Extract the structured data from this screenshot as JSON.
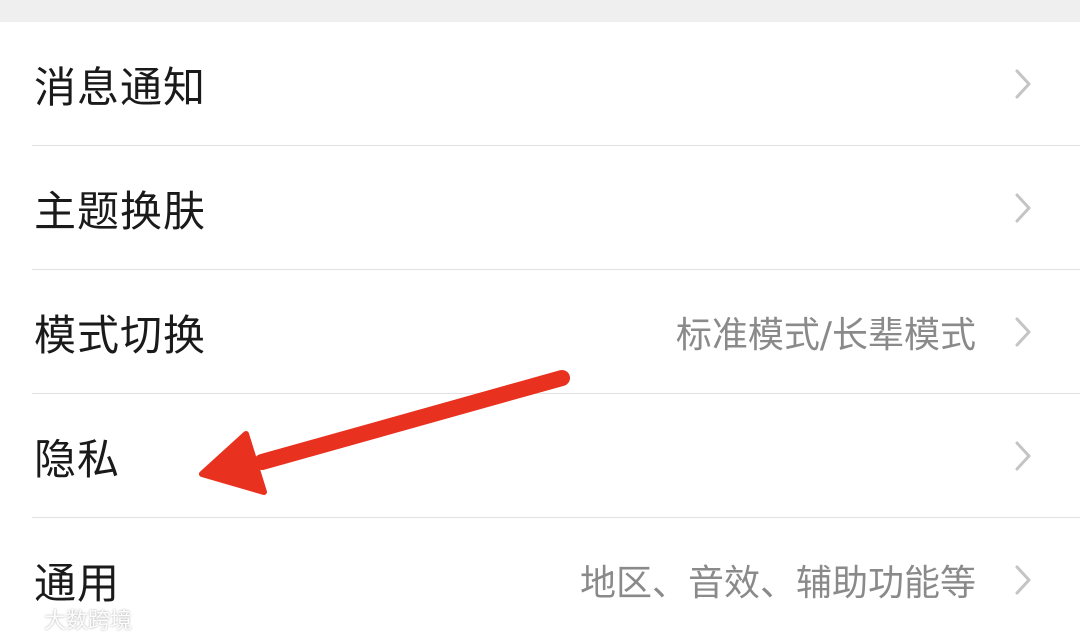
{
  "settings": {
    "items": [
      {
        "label": "消息通知",
        "value": ""
      },
      {
        "label": "主题换肤",
        "value": ""
      },
      {
        "label": "模式切换",
        "value": "标准模式/长辈模式"
      },
      {
        "label": "隐私",
        "value": ""
      },
      {
        "label": "通用",
        "value": "地区、音效、辅助功能等"
      }
    ]
  },
  "icons": {
    "row_chevron": "chevron-right-icon",
    "annotation": "red-arrow-icon",
    "watermark_logo": "logo-icon"
  },
  "colors": {
    "annotation_arrow": "#e8311f",
    "divider": "#e2e2e2",
    "label_text": "#1a1a1a",
    "value_text": "#8a8a8a",
    "chevron": "#c4c4c4"
  },
  "watermark": {
    "text": "大数跨境"
  }
}
